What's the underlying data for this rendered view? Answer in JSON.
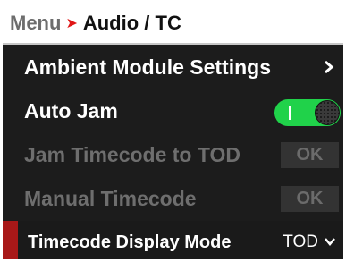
{
  "breadcrumb": {
    "root": "Menu",
    "separator": "➤",
    "current": "Audio / TC"
  },
  "items": [
    {
      "label": "Ambient Module Settings",
      "control": "submenu-chevron",
      "enabled": true
    },
    {
      "label": "Auto Jam",
      "control": "toggle",
      "state": "on",
      "enabled": true
    },
    {
      "label": "Jam Timecode to TOD",
      "control": "button",
      "button_label": "OK",
      "enabled": false
    },
    {
      "label": "Manual Timecode",
      "control": "button",
      "button_label": "OK",
      "enabled": false
    },
    {
      "label": "Timecode Display Mode",
      "control": "dropdown",
      "value": "TOD",
      "selected": true,
      "enabled": true
    }
  ],
  "colors": {
    "accent_red": "#e01616",
    "selection_marker": "#a81818",
    "toggle_on": "#20d24a",
    "background": "#1c1c1c"
  }
}
